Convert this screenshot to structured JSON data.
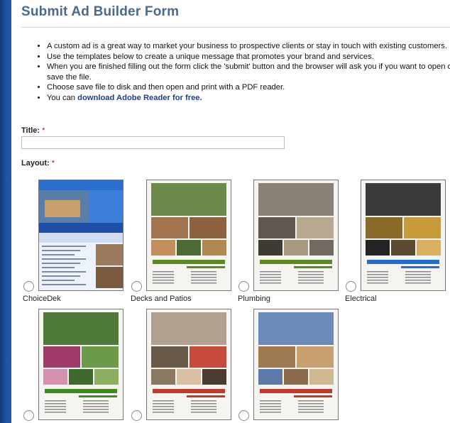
{
  "form": {
    "title": "Submit Ad Builder Form",
    "bullets": [
      "A custom ad is a great way to market your business to prospective clients or stay in touch with existing customers.",
      "Use the templates below to create a unique message that promotes your brand and services.",
      "When you are finished filling out the form click the 'submit' button and the browser will ask you if you want to open or save the file.",
      "Choose save file to disk and then open and print with a PDF reader."
    ],
    "bullet5_prefix": "You can ",
    "bullet5_link": "download Adobe Reader for free.",
    "title_label": "Title:",
    "layout_label": "Layout:",
    "required_mark": "*",
    "title_value": ""
  },
  "layouts": [
    {
      "name": "ChoiceDek",
      "brand": "GREAT CONTRACTORS, INC.",
      "tagline": "The beauty of wood without the worry",
      "accent": "#1e6fcf"
    },
    {
      "name": "Decks and Patios",
      "brand": "GREAT CONTRACTORS INC.",
      "tagline": "YOUR OUTDOOR SOLUTION",
      "accent": "#5a8a1e"
    },
    {
      "name": "Plumbing",
      "brand": "GREAT CONTRACTORS INC.",
      "tagline": "YOUR PLUMBING SOLUTION",
      "accent": "#5a8a1e"
    },
    {
      "name": "Electrical",
      "brand": "GREAT CONTRACTORS INC.",
      "tagline": "YOUR ELECTRICAL SOLUTION",
      "accent": "#1e6fcf"
    },
    {
      "name": "",
      "brand": "GREAT CONTRACTORS INC.",
      "tagline": "YOUR LANDSCAPING SOLUTION",
      "accent": "#3f8a22"
    },
    {
      "name": "",
      "brand": "GREAT CONTRACTORS INC.",
      "tagline": "YOUR PAINTING SOLUTION",
      "accent": "#c0392b"
    },
    {
      "name": "",
      "brand": "GREAT CONTRACTORS INC.",
      "tagline": "YOUR HOME REMODELING SOLUTION",
      "accent": "#c0392b"
    }
  ],
  "colors": {
    "frame": "#1f57a6",
    "heading": "#4a6a8c",
    "link": "#1d3f8f",
    "required": "#cc0000"
  }
}
